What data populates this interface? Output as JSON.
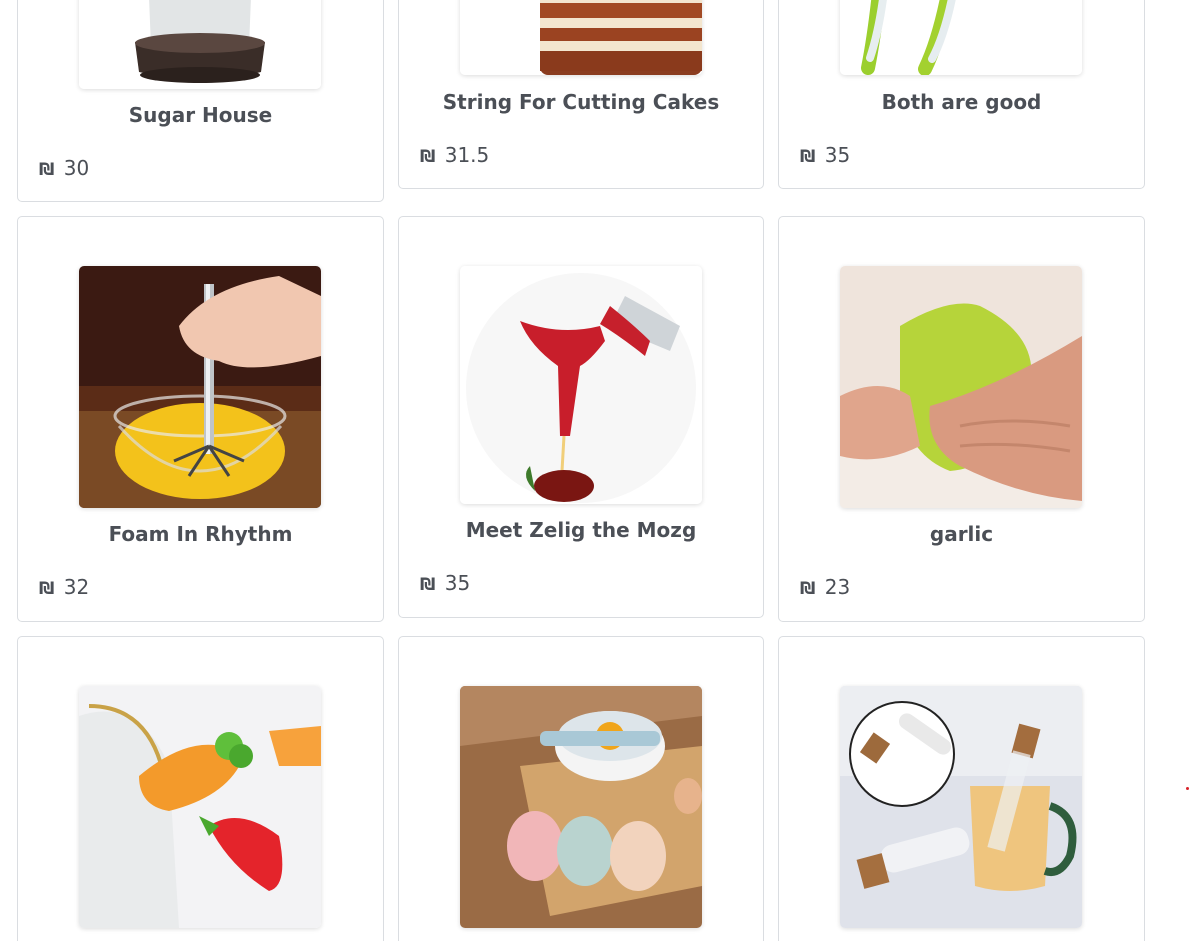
{
  "currency_symbol": "₪",
  "products": [
    {
      "title": "Sugar House",
      "price": "30",
      "image": "sugar-dispenser-image"
    },
    {
      "title": "String For Cutting Cakes",
      "price": "31.5",
      "image": "layer-cake-image"
    },
    {
      "title": "Both are good",
      "price": "35",
      "image": "green-tongs-image"
    },
    {
      "title": "Foam In Rhythm",
      "price": "32",
      "image": "push-whisk-image"
    },
    {
      "title": "Meet Zelig the Mozg",
      "price": "35",
      "image": "red-bottle-pourer-image"
    },
    {
      "title": "garlic",
      "price": "23",
      "image": "silicone-garlic-peeler-image"
    },
    {
      "title": "",
      "price": "",
      "image": "carrot-pot-clip-image"
    },
    {
      "title": "",
      "price": "",
      "image": "egg-separator-image"
    },
    {
      "title": "",
      "price": "",
      "image": "tea-infuser-tube-image"
    }
  ]
}
